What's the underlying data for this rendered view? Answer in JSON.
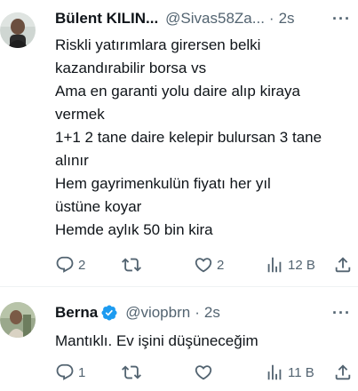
{
  "tweets": [
    {
      "name": "Bülent KILIN...",
      "handle": "@Sivas58Za...",
      "separator": "·",
      "time": "2s",
      "lines": [
        "Riskli yatırımlara girersen belki",
        "kazandırabilir borsa vs",
        "Ama en garanti yolu daire alıp kiraya",
        "vermek",
        "1+1 2 tane daire kelepir bulursan 3 tane",
        "alınır",
        "Hem gayrimenkulün fiyatı her yıl",
        "üstüne koyar",
        "Hemde aylık 50 bin kira"
      ],
      "replies": "2",
      "retweets": "",
      "likes": "2",
      "views": "12 B",
      "verified": false
    },
    {
      "name": "Berna",
      "handle": "@viopbrn",
      "separator": "·",
      "time": "2s",
      "lines": [
        "Mantıklı. Ev işini düşüneceğim"
      ],
      "replies": "1",
      "retweets": "",
      "likes": "",
      "views": "11 B",
      "verified": true
    }
  ],
  "colors": {
    "text": "#0f1419",
    "secondary": "#536471",
    "verified": "#1d9bf0",
    "divider": "#eff3f4"
  }
}
